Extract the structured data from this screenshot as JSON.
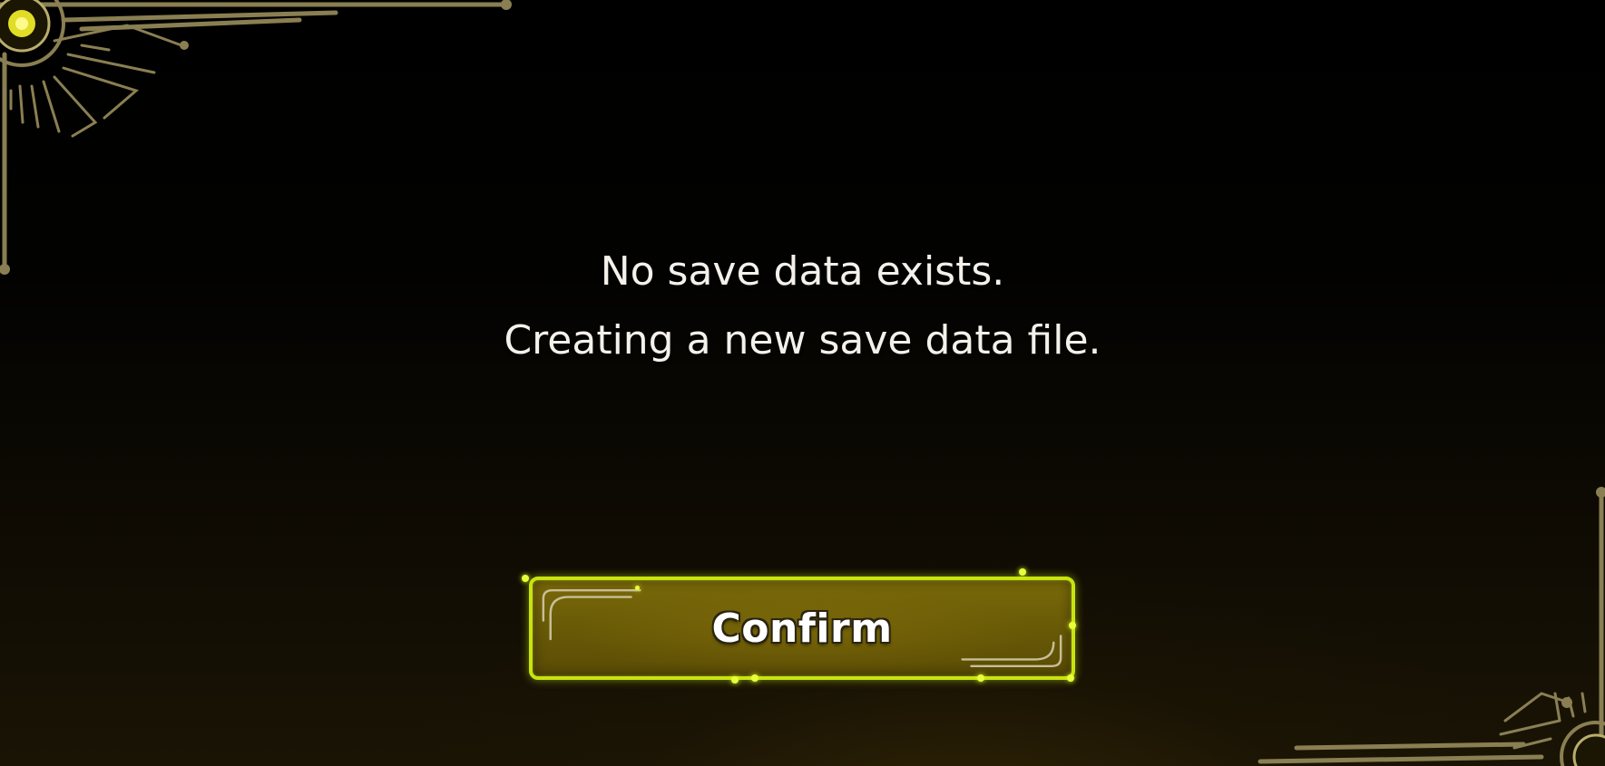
{
  "dialog": {
    "message_line1": "No save data exists.",
    "message_line2": "Creating a new save data file.",
    "confirm_label": "Confirm"
  },
  "colors": {
    "background": "#000000",
    "frame_gold": "#8a7f52",
    "button_border": "#c8e40e",
    "button_fill": "#6a5b07",
    "text": "#f4f1ea"
  },
  "icons": {
    "top_left": "ornamental-corner-frame",
    "bottom_right": "ornamental-corner-frame"
  }
}
